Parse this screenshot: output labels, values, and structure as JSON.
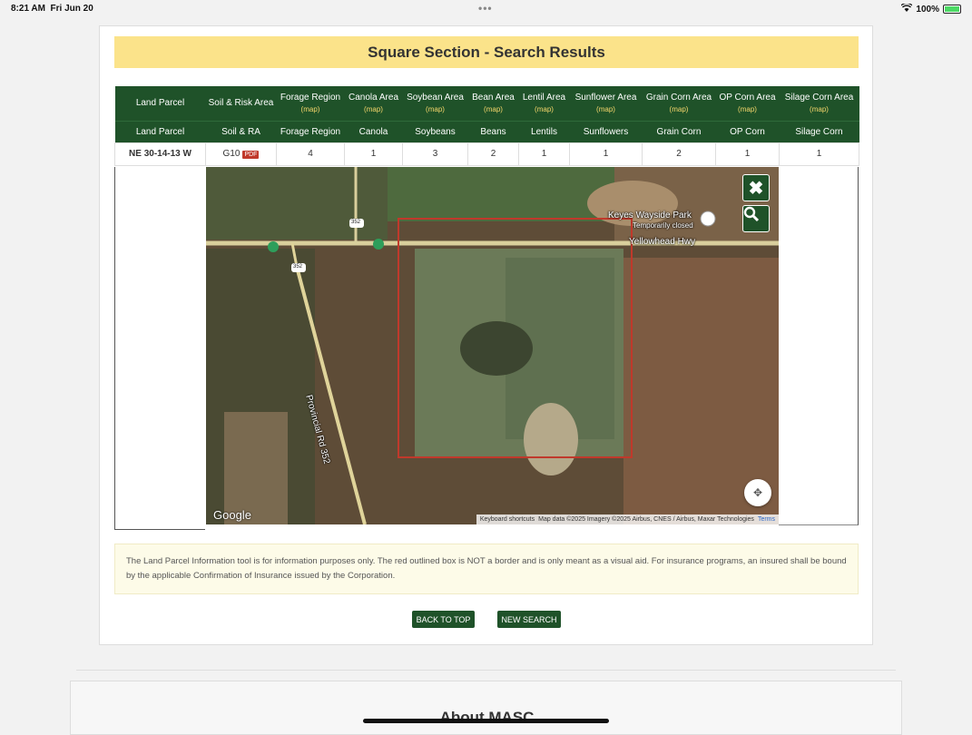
{
  "status_bar": {
    "time": "8:21 AM",
    "date": "Fri Jun 20",
    "battery": "100%"
  },
  "page": {
    "title": "Square Section - Search Results"
  },
  "table": {
    "header_row1": [
      {
        "label": "Land Parcel",
        "sub": ""
      },
      {
        "label": "Soil & Risk Area",
        "sub": ""
      },
      {
        "label": "Forage Region",
        "sub": "(map)"
      },
      {
        "label": "Canola Area",
        "sub": "(map)"
      },
      {
        "label": "Soybean Area",
        "sub": "(map)"
      },
      {
        "label": "Bean Area",
        "sub": "(map)"
      },
      {
        "label": "Lentil Area",
        "sub": "(map)"
      },
      {
        "label": "Sunflower Area",
        "sub": "(map)"
      },
      {
        "label": "Grain Corn Area",
        "sub": "(map)"
      },
      {
        "label": "OP Corn Area",
        "sub": "(map)"
      },
      {
        "label": "Silage Corn Area",
        "sub": "(map)"
      }
    ],
    "header_row2": [
      "Land Parcel",
      "Soil & RA",
      "Forage Region",
      "Canola",
      "Soybeans",
      "Beans",
      "Lentils",
      "Sunflowers",
      "Grain Corn",
      "OP Corn",
      "Silage Corn"
    ],
    "row": {
      "parcel": "NE 30-14-13  W",
      "soil": "G10",
      "pdf": "PDF",
      "values": [
        "4",
        "1",
        "3",
        "2",
        "1",
        "1",
        "2",
        "1",
        "1"
      ]
    }
  },
  "map": {
    "place_name": "Keyes Wayside Park",
    "place_status": "Temporarily closed",
    "highway": "Yellowhead Hwy",
    "road": "Provincial Rd 352",
    "route_shield": "352",
    "google": "Google",
    "shortcuts": "Keyboard shortcuts",
    "map_data": "Map data ©2025 Imagery ©2025 Airbus, CNES / Airbus, Maxar Technologies",
    "terms": "Terms",
    "close_icon": "close-icon",
    "search_icon": "search-icon"
  },
  "disclaimer": "The Land Parcel Information tool is for information purposes only. The red outlined box is NOT a border and is only meant as a visual aid. For insurance programs, an insured shall be bound by the applicable Confirmation of Insurance issued by the Corporation.",
  "buttons": {
    "back_to_top": "BACK TO TOP",
    "new_search": "NEW SEARCH"
  },
  "about": {
    "title": "About MASC"
  },
  "colors": {
    "header_green": "#1f5229",
    "title_yellow": "#fbe38a",
    "map_sub": "#f5d66b"
  }
}
